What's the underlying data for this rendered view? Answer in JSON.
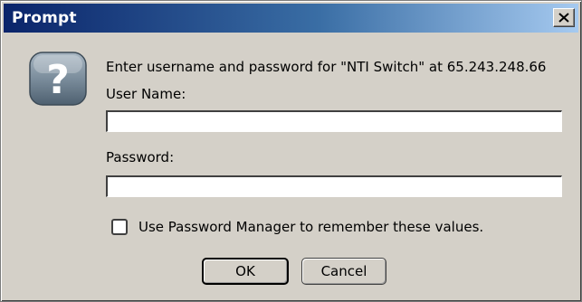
{
  "dialog": {
    "title": "Prompt",
    "message": "Enter username and password for \"NTI Switch\" at 65.243.248.66",
    "username": {
      "label": "User Name:",
      "value": ""
    },
    "password": {
      "label": "Password:",
      "value": ""
    },
    "remember": {
      "label": "Use Password Manager to remember these values.",
      "checked": false
    },
    "buttons": {
      "ok": "OK",
      "cancel": "Cancel"
    }
  },
  "colors": {
    "titlebar_start": "#0a246a",
    "titlebar_end": "#a6caf0",
    "dialog_bg": "#d4d0c8"
  },
  "icons": {
    "close": "close-icon",
    "help": "question-mark-icon",
    "checkbox": "checkbox"
  }
}
